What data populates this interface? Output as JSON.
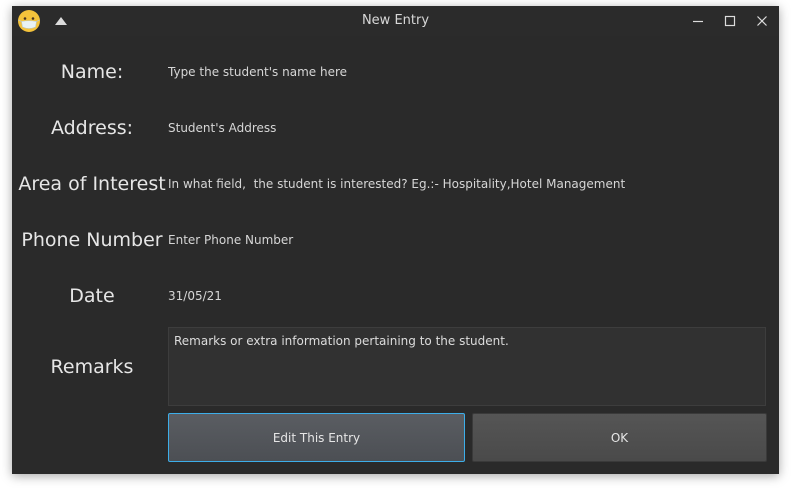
{
  "window": {
    "title": "New Entry"
  },
  "form": {
    "name": {
      "label": "Name:",
      "placeholder": "Type the student's name here"
    },
    "address": {
      "label": "Address:",
      "placeholder": "Student's Address"
    },
    "interest": {
      "label": "Area of Interest",
      "placeholder": "In what field,  the student is interested? Eg.:- Hospitality,Hotel Management"
    },
    "phone": {
      "label": "Phone Number",
      "placeholder": "Enter Phone Number"
    },
    "date": {
      "label": "Date",
      "value": "31/05/21"
    },
    "remarks": {
      "label": "Remarks",
      "placeholder": "Remarks or extra information pertaining to the student."
    }
  },
  "buttons": {
    "edit_label": "Edit This Entry",
    "ok_label": "OK"
  },
  "colors": {
    "background": "#2a2a2a",
    "focus_accent": "#3daee9",
    "text": "#e6e6e6"
  },
  "icons": {
    "app": "face-mask-emoji-icon",
    "keep_above": "triangle-up-icon",
    "minimize": "minimize-icon",
    "maximize": "maximize-icon",
    "close": "close-icon"
  }
}
